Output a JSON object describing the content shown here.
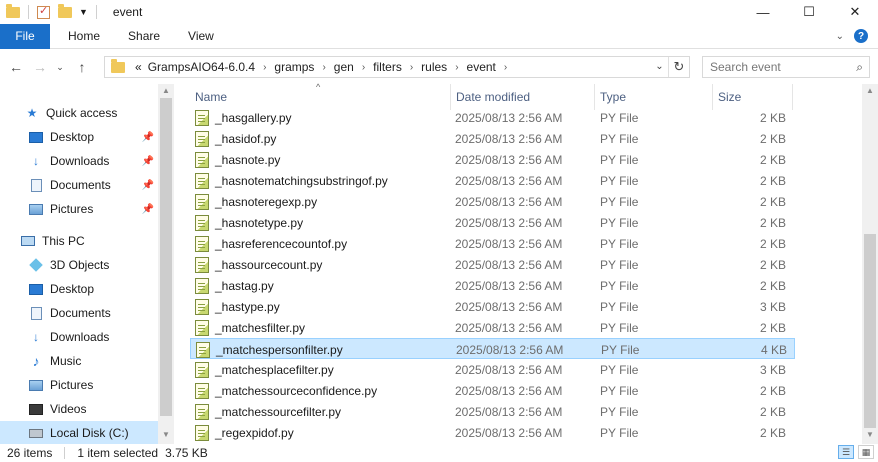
{
  "window": {
    "title": "event",
    "minimize": "—",
    "maximize": "☐",
    "close": "✕"
  },
  "ribbon": {
    "file": "File",
    "tabs": [
      "Home",
      "Share",
      "View"
    ]
  },
  "address": {
    "prefix": "«",
    "crumbs": [
      "GrampsAIO64-6.0.4",
      "gramps",
      "gen",
      "filters",
      "rules",
      "event"
    ],
    "search_placeholder": "Search event"
  },
  "nav_pane": {
    "quick_access": "Quick access",
    "quick_items": [
      "Desktop",
      "Downloads",
      "Documents",
      "Pictures"
    ],
    "this_pc": "This PC",
    "pc_items": [
      "3D Objects",
      "Desktop",
      "Documents",
      "Downloads",
      "Music",
      "Pictures",
      "Videos",
      "Local Disk (C:)"
    ]
  },
  "columns": {
    "name": "Name",
    "date": "Date modified",
    "type": "Type",
    "size": "Size"
  },
  "files": [
    {
      "name": "_hasgallery.py",
      "date": "2025/08/13 2:56 AM",
      "type": "PY File",
      "size": "2 KB"
    },
    {
      "name": "_hasidof.py",
      "date": "2025/08/13 2:56 AM",
      "type": "PY File",
      "size": "2 KB"
    },
    {
      "name": "_hasnote.py",
      "date": "2025/08/13 2:56 AM",
      "type": "PY File",
      "size": "2 KB"
    },
    {
      "name": "_hasnotematchingsubstringof.py",
      "date": "2025/08/13 2:56 AM",
      "type": "PY File",
      "size": "2 KB"
    },
    {
      "name": "_hasnoteregexp.py",
      "date": "2025/08/13 2:56 AM",
      "type": "PY File",
      "size": "2 KB"
    },
    {
      "name": "_hasnotetype.py",
      "date": "2025/08/13 2:56 AM",
      "type": "PY File",
      "size": "2 KB"
    },
    {
      "name": "_hasreferencecountof.py",
      "date": "2025/08/13 2:56 AM",
      "type": "PY File",
      "size": "2 KB"
    },
    {
      "name": "_hassourcecount.py",
      "date": "2025/08/13 2:56 AM",
      "type": "PY File",
      "size": "2 KB"
    },
    {
      "name": "_hastag.py",
      "date": "2025/08/13 2:56 AM",
      "type": "PY File",
      "size": "2 KB"
    },
    {
      "name": "_hastype.py",
      "date": "2025/08/13 2:56 AM",
      "type": "PY File",
      "size": "3 KB"
    },
    {
      "name": "_matchesfilter.py",
      "date": "2025/08/13 2:56 AM",
      "type": "PY File",
      "size": "2 KB"
    },
    {
      "name": "_matchespersonfilter.py",
      "date": "2025/08/13 2:56 AM",
      "type": "PY File",
      "size": "4 KB"
    },
    {
      "name": "_matchesplacefilter.py",
      "date": "2025/08/13 2:56 AM",
      "type": "PY File",
      "size": "3 KB"
    },
    {
      "name": "_matchessourceconfidence.py",
      "date": "2025/08/13 2:56 AM",
      "type": "PY File",
      "size": "2 KB"
    },
    {
      "name": "_matchessourcefilter.py",
      "date": "2025/08/13 2:56 AM",
      "type": "PY File",
      "size": "2 KB"
    },
    {
      "name": "_regexpidof.py",
      "date": "2025/08/13 2:56 AM",
      "type": "PY File",
      "size": "2 KB"
    }
  ],
  "status": {
    "count": "26 items",
    "selected": "1 item selected",
    "selected_size": "3.75 KB"
  },
  "colors": {
    "accent": "#1a6fc9",
    "selection": "#cce8ff",
    "selection_border": "#99d1ff"
  }
}
